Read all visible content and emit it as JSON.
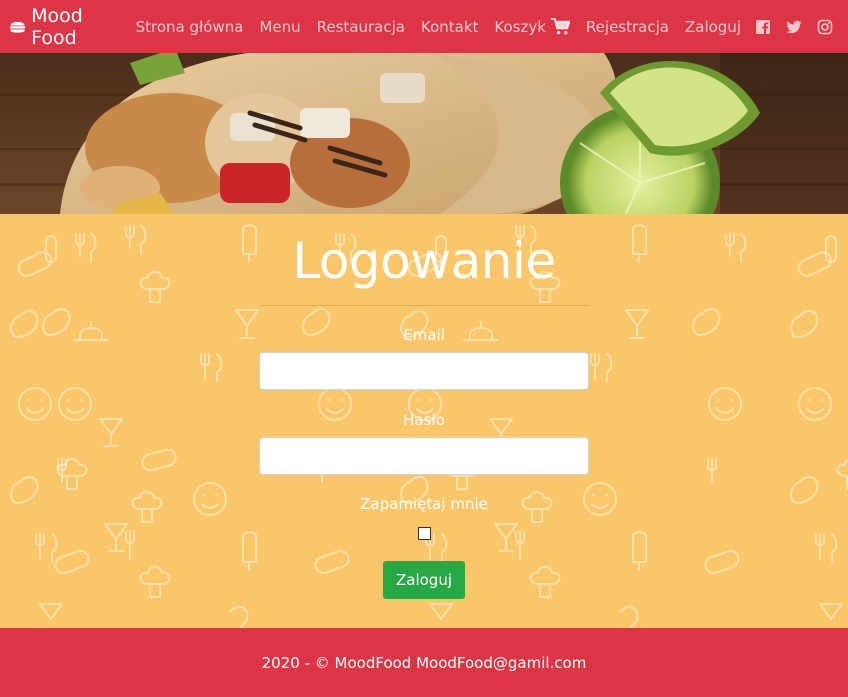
{
  "brand": {
    "name": "Mood Food",
    "icon": "hamburger-icon"
  },
  "nav": {
    "items": [
      {
        "label": "Strona główna"
      },
      {
        "label": "Menu"
      },
      {
        "label": "Restauracja"
      },
      {
        "label": "Kontakt"
      },
      {
        "label": "Koszyk",
        "icon": "cart-icon"
      },
      {
        "label": "Rejestracja"
      },
      {
        "label": "Zaloguj"
      }
    ],
    "social": [
      "facebook-icon",
      "twitter-icon",
      "instagram-icon"
    ]
  },
  "hero": {
    "description_icon": "food-burrito-photo"
  },
  "login": {
    "title": "Logowanie",
    "email_label": "Email",
    "email_value": "",
    "password_label": "Hasło",
    "password_value": "",
    "remember_label": "Zapamiętaj mnie",
    "remember_checked": false,
    "submit_label": "Zaloguj"
  },
  "footer": {
    "text": "2020 - © MoodFood MoodFood@gamil.com"
  },
  "colors": {
    "primary": "#dc3545",
    "background": "#f9c66a",
    "button": "#28a745",
    "text": "#ffffff"
  }
}
